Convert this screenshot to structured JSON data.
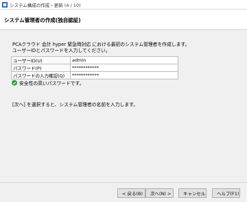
{
  "window": {
    "title": "システム構成の作成・更新 (4 / 10)"
  },
  "header": {
    "title": "システム管理者の作成(独自認証)"
  },
  "description": {
    "line1": "PCAクラウド 会計 hyper 緊急時対応 における最初のシステム管理者を作成します。",
    "line2": "ユーザーIDとパスワードを入力してください。"
  },
  "form": {
    "user_id_label": "ユーザーID(U)",
    "user_id_value": "admin",
    "password_label": "パスワード(P)",
    "password_value": "************",
    "confirm_label": "パスワードの入力確認(Q)",
    "confirm_value": "************"
  },
  "status": {
    "text": "安全性の高いパスワードです。",
    "icon": "check-circle-icon",
    "color": "#2e9b3e"
  },
  "hint": {
    "text": "[次へ] を選択すると、システム管理者の名前を入力します。"
  },
  "buttons": {
    "back": "< 戻る(B)",
    "next": "次へ(N) >",
    "cancel": "キャンセル",
    "help": "ヘルプ(F1)"
  }
}
